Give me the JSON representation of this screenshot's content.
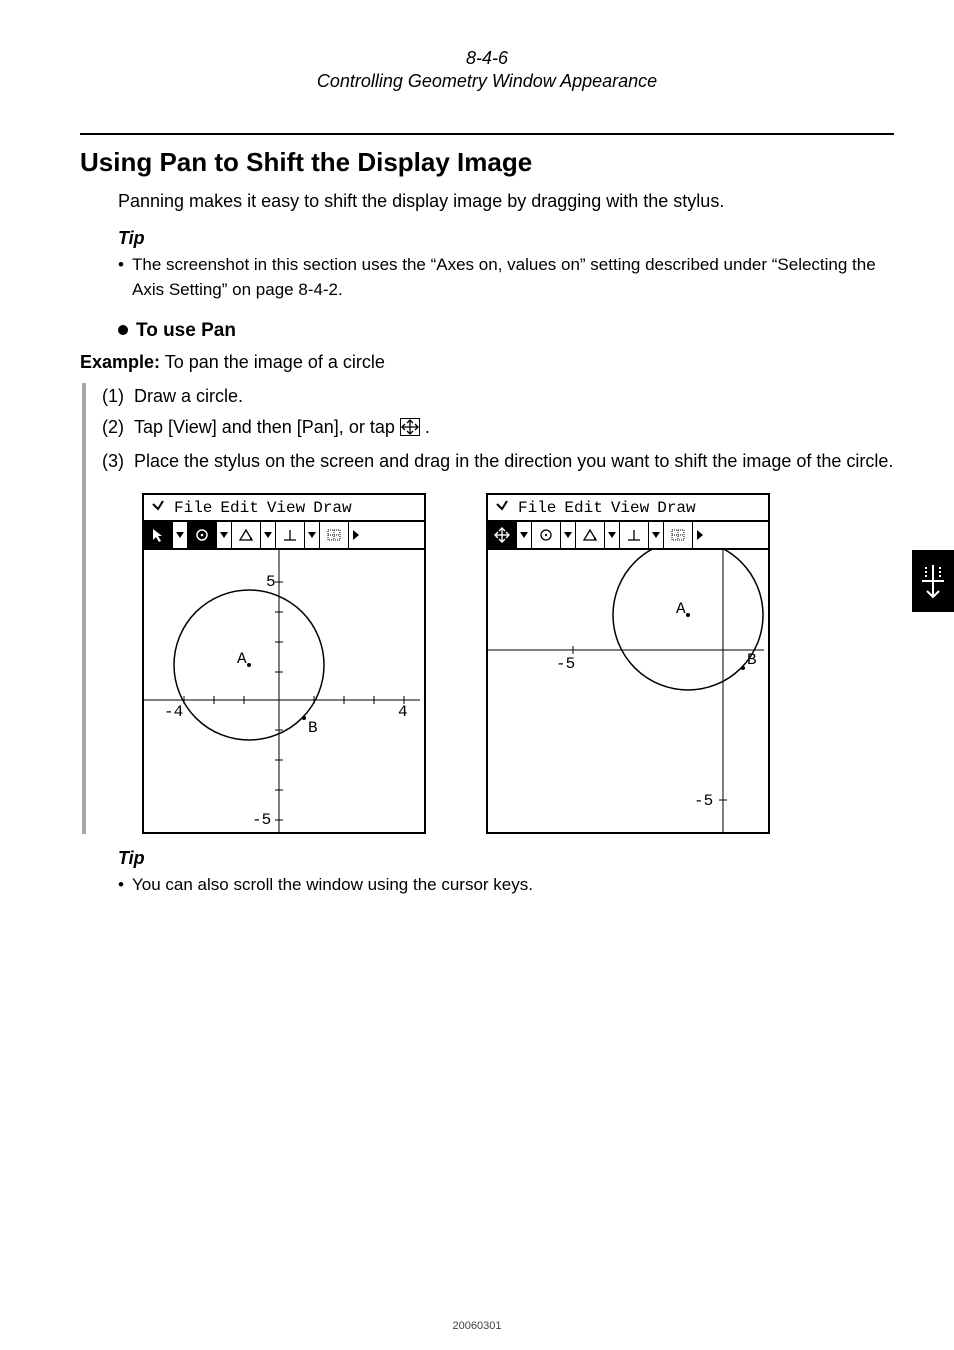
{
  "header": {
    "page_number": "8-4-6",
    "title": "Controlling Geometry Window Appearance"
  },
  "section": {
    "heading": "Using Pan to Shift the Display Image",
    "intro": "Panning makes it easy to shift the display image by dragging with the stylus."
  },
  "tip1": {
    "label": "Tip",
    "text": "The screenshot in this section uses the “Axes on, values on” setting described under “Selecting the Axis Setting” on page 8-4-2."
  },
  "subheading": "To use Pan",
  "example": {
    "label": "Example:",
    "text": "To pan the image of a circle"
  },
  "steps": [
    {
      "num": "(1)",
      "text": "Draw a circle."
    },
    {
      "num": "(2)",
      "text_before": "Tap [View] and then [Pan], or tap ",
      "text_after": "."
    },
    {
      "num": "(3)",
      "text": "Place the stylus on the screen and drag in the direction you want to shift the image of the circle."
    }
  ],
  "screens": {
    "menubar": [
      "File",
      "Edit",
      "View",
      "Draw"
    ],
    "toolbar_icons": [
      "arrow-icon",
      "circle-icon",
      "triangle-icon",
      "perpendicular-icon",
      "grid-icon"
    ],
    "left": {
      "active_tool": "arrow-icon",
      "axis_ticks": {
        "top": "5",
        "right": "4",
        "left": "-4",
        "bottom": "-5"
      },
      "points": [
        "A",
        "B"
      ]
    },
    "right": {
      "active_tool": "pan-icon",
      "axis_ticks": {
        "center": "-5",
        "bottom": "-5"
      },
      "points": [
        "A",
        "B"
      ]
    }
  },
  "tip2": {
    "label": "Tip",
    "text": "You can also scroll the window using the cursor keys."
  },
  "footer": "20060301"
}
